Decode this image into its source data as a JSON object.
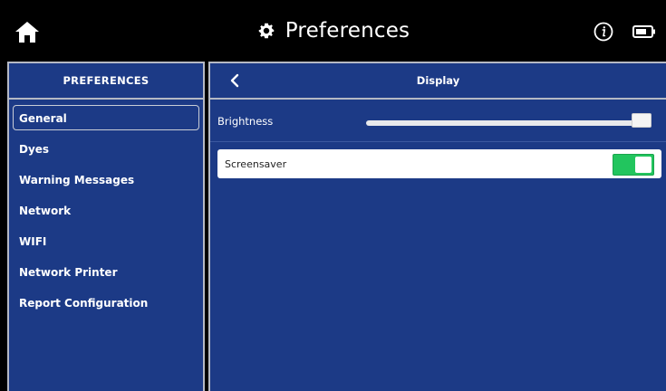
{
  "header": {
    "title": "Preferences",
    "icons": [
      "home-icon",
      "gear-icon",
      "info-icon",
      "battery-icon"
    ]
  },
  "sidebar": {
    "header": "PREFERENCES",
    "items": [
      {
        "label": "General",
        "active": true
      },
      {
        "label": "Dyes",
        "active": false
      },
      {
        "label": "Warning Messages",
        "active": false
      },
      {
        "label": "Network",
        "active": false
      },
      {
        "label": "WIFI",
        "active": false
      },
      {
        "label": "Network Printer",
        "active": false
      },
      {
        "label": "Report Configuration",
        "active": false
      }
    ]
  },
  "main": {
    "title": "Display",
    "back_icon": "chevron-left-icon",
    "brightness": {
      "label": "Brightness",
      "value_fraction": 0.98
    },
    "screensaver": {
      "label": "Screensaver",
      "enabled": true
    }
  },
  "colors": {
    "panel": "#1c3a86",
    "toggle_on": "#22c55e",
    "top_bar": "#000000"
  }
}
